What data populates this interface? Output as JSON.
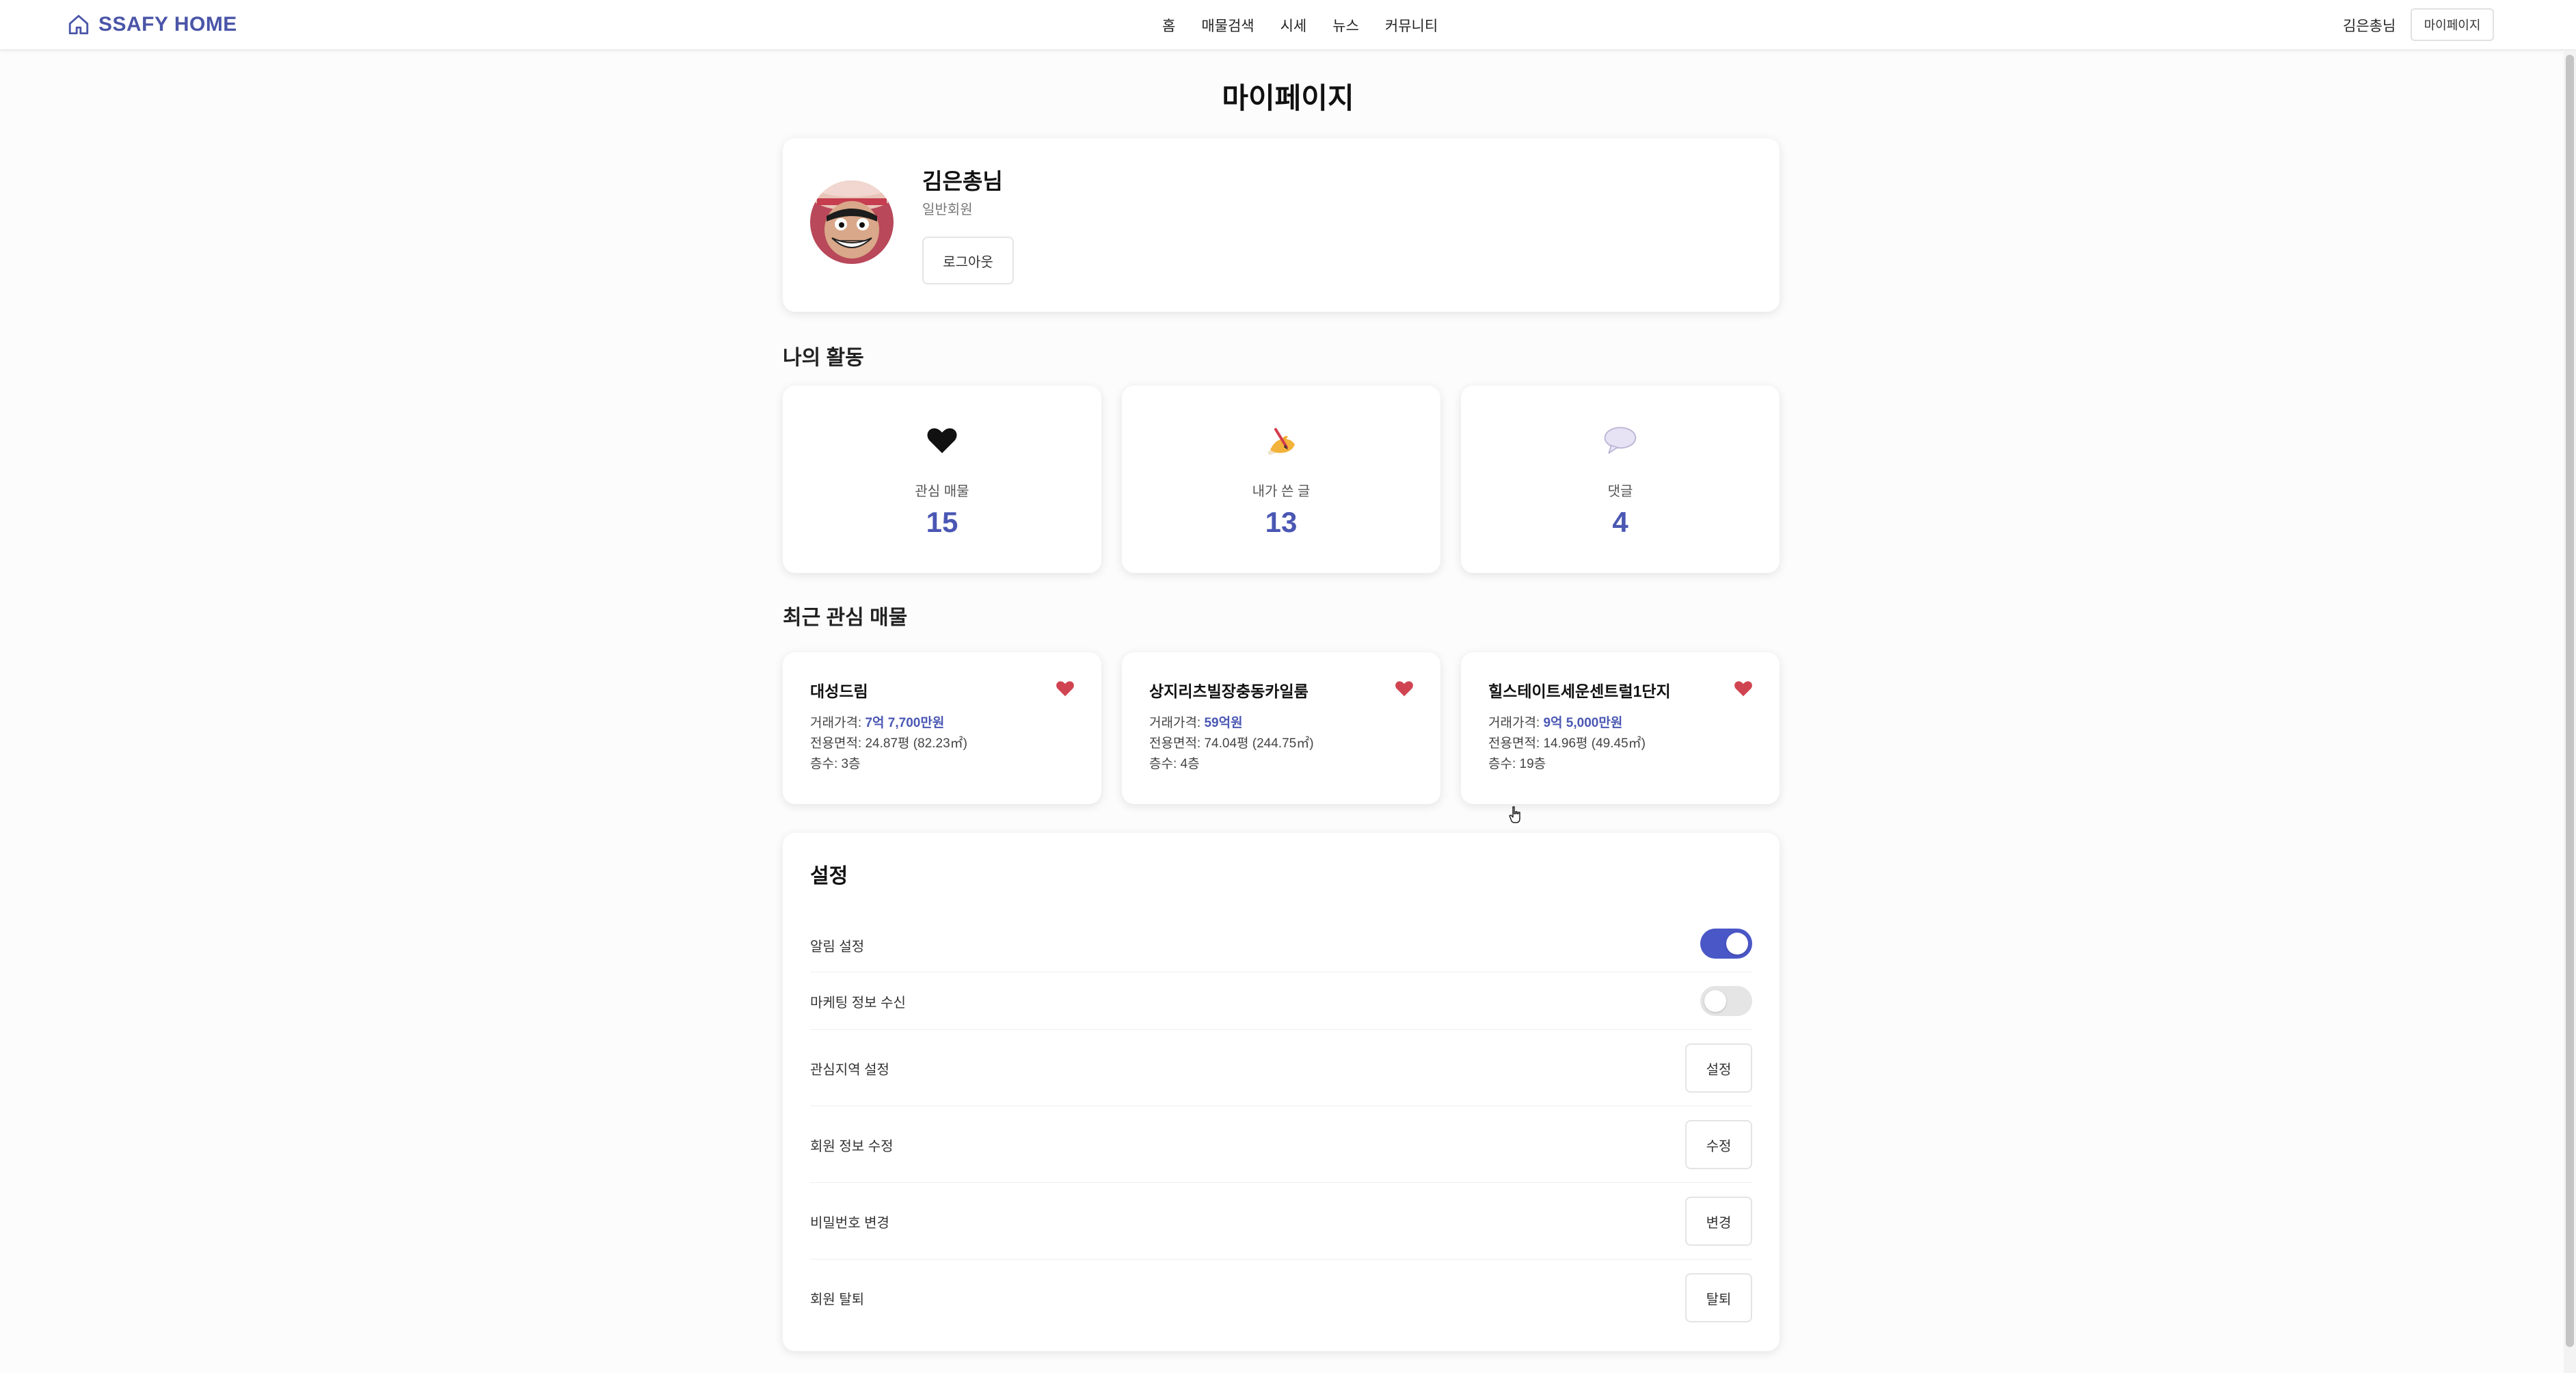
{
  "header": {
    "brand": "SSAFY HOME",
    "nav": [
      "홈",
      "매물검색",
      "시세",
      "뉴스",
      "커뮤니티"
    ],
    "user_name": "김은총님",
    "mypage_button": "마이페이지"
  },
  "page": {
    "title": "마이페이지"
  },
  "profile": {
    "name": "김은총님",
    "role": "일반회원",
    "logout_button": "로그아웃"
  },
  "activity": {
    "title": "나의 활동",
    "items": [
      {
        "icon": "heart-icon",
        "label": "관심 매물",
        "value": "15"
      },
      {
        "icon": "writing-hand-icon",
        "label": "내가 쓴 글",
        "value": "13"
      },
      {
        "icon": "speech-bubble-icon",
        "label": "댓글",
        "value": "4"
      }
    ]
  },
  "favorites": {
    "title": "최근 관심 매물",
    "items": [
      {
        "name": "대성드림",
        "price_label": "거래가격: ",
        "price": "7억 7,700만원",
        "area": "전용면적: 24.87평 (82.23㎡)",
        "floor": "층수: 3층"
      },
      {
        "name": "상지리츠빌장충동카일룸",
        "price_label": "거래가격: ",
        "price": "59억원",
        "area": "전용면적: 74.04평 (244.75㎡)",
        "floor": "층수: 4층"
      },
      {
        "name": "힐스테이트세운센트럴1단지",
        "price_label": "거래가격: ",
        "price": "9억 5,000만원",
        "area": "전용면적: 14.96평 (49.45㎡)",
        "floor": "층수: 19층"
      }
    ]
  },
  "settings": {
    "title": "설정",
    "rows": [
      {
        "label": "알림 설정",
        "type": "toggle",
        "enabled": true
      },
      {
        "label": "마케팅 정보 수신",
        "type": "toggle",
        "enabled": false
      },
      {
        "label": "관심지역 설정",
        "type": "button",
        "button": "설정"
      },
      {
        "label": "회원 정보 수정",
        "type": "button",
        "button": "수정"
      },
      {
        "label": "비밀번호 변경",
        "type": "button",
        "button": "변경"
      },
      {
        "label": "회원 탈퇴",
        "type": "button",
        "button": "탈퇴"
      }
    ]
  },
  "colors": {
    "accent": "#4a57b3",
    "toggle_on": "#4a57c7",
    "heart_red": "#d04451"
  }
}
